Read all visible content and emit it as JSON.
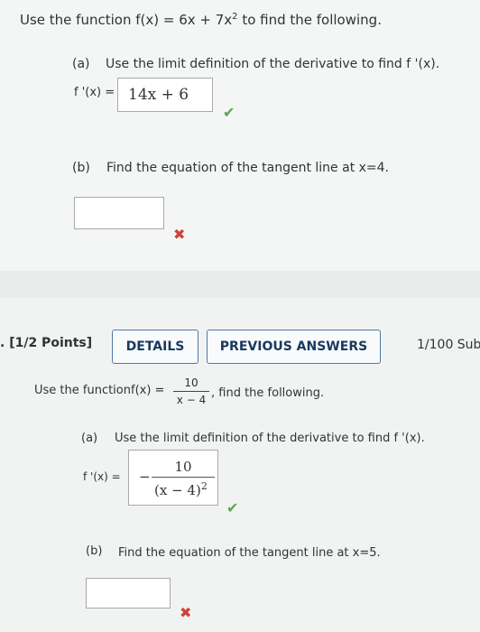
{
  "q1": {
    "prompt_prefix": "Use the function",
    "prompt_function": "f(x) = 6x + 7x",
    "prompt_exponent": "2",
    "prompt_suffix": "to find the following.",
    "part_a": {
      "letter": "(a)",
      "instruction": "Use the limit definition of the derivative to find f '(x).",
      "answer_label": "f '(x) =",
      "answer_value": "14x + 6",
      "status": "correct"
    },
    "part_b": {
      "letter": "(b)",
      "instruction": "Find the equation of the tangent line at x=4.",
      "answer_value": "",
      "status": "incorrect"
    }
  },
  "q2": {
    "number_fragment": ". [1/2 Points]",
    "details_button": "DETAILS",
    "previous_answers_button": "PREVIOUS ANSWERS",
    "submissions": "1/100 Sub",
    "prompt_prefix": "Use the function",
    "prompt_lhs": "f(x) =",
    "frac_num": "10",
    "frac_den": "x − 4",
    "prompt_suffix": ", find the following.",
    "part_a": {
      "letter": "(a)",
      "instruction": "Use the limit definition of the derivative to find f '(x).",
      "answer_label": "f '(x) =",
      "answer_sign": "−",
      "answer_num": "10",
      "answer_den": "(x − 4)",
      "answer_exp": "2",
      "status": "correct"
    },
    "part_b": {
      "letter": "(b)",
      "instruction": "Find the equation of the tangent line at x=5.",
      "answer_value": "",
      "status": "incorrect"
    }
  },
  "colors": {
    "correct": "#5aa54a",
    "incorrect": "#d0413a",
    "button_text": "#17395e"
  },
  "icons": {
    "correct": "checkmark-icon",
    "incorrect": "cross-icon"
  }
}
